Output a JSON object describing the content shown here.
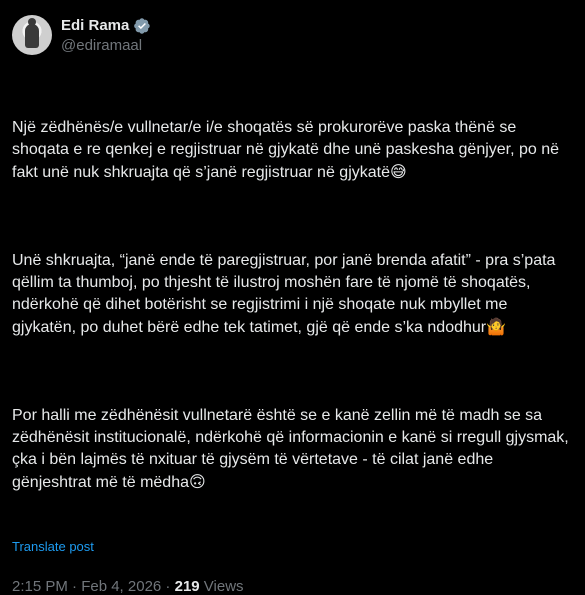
{
  "author": {
    "display_name": "Edi Rama",
    "handle": "@ediramaal",
    "verified_color": "#829aab"
  },
  "post": {
    "paragraphs": [
      {
        "text": "Një zëdhënës/e vullnetar/e i/e shoqatës së prokurorëve paska thënë se shoqata e re qenkej e regjistruar në gjykatë dhe unë paskesha gënjyer, po në fakt unë nuk shkruajta që s’janë regjistruar në gjykatë",
        "emoji": "😅"
      },
      {
        "text": "Unë shkruajta, “janë ende të paregjistruar, por janë brenda afatit” - pra s’pata qëllim ta thumboj, po thjesht të ilustroj moshën fare të njomë të shoqatës, ndërkohë që dihet botërisht se regjistrimi i një shoqate nuk mbyllet me gjykatën, po duhet bërë edhe tek tatimet, gjë që ende s’ka ndodhur",
        "emoji": "🤷"
      },
      {
        "text": "Por halli me zëdhënësit vullnetarë është se e kanë zellin më të madh se sa zëdhënësit institucionalë, ndërkohë që informacionin e kanë si rregull gjysmak, çka i bën lajmës të nxituar të gjysëm të vërtetave - të cilat janë edhe gënjeshtrat më të mëdha",
        "emoji": "🙃"
      }
    ],
    "translate_label": "Translate post",
    "timestamp": "2:15 PM · Feb 4, 2026",
    "separator": " · ",
    "views_count": "219",
    "views_label": " Views"
  }
}
